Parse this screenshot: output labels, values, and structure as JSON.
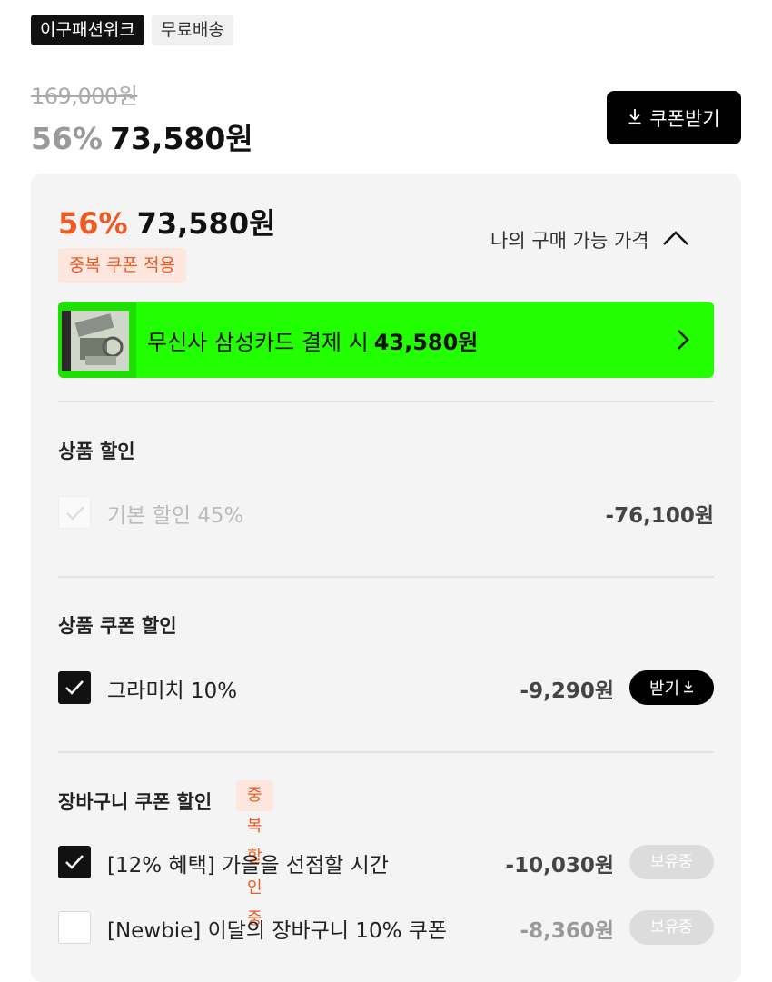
{
  "badges": {
    "store": "이구패션위크",
    "shipping": "무료배송"
  },
  "pricing": {
    "original": "169,000원",
    "discount_pct": "56%",
    "sale_price": "73,580원"
  },
  "coupon_button": {
    "label": "쿠폰받기",
    "icon": "download-icon"
  },
  "panel": {
    "discount_pct": "56%",
    "price": "73,580원",
    "dup_tag": "중복 쿠폰 적용",
    "mine_label": "나의 구매 가능 가격",
    "mine_icon": "chevron-up-icon",
    "card": {
      "text": "무신사 삼성카드 결제 시",
      "amount": "43,580원",
      "thumb_icon": "card-thumbnail-image",
      "chevron_icon": "chevron-right-icon"
    },
    "product_discount": {
      "title": "상품 할인",
      "items": [
        {
          "label": "기본 할인 45%",
          "amount": "-76,100원",
          "checked": true,
          "disabled": true
        }
      ]
    },
    "product_coupon": {
      "title": "상품 쿠폰 할인",
      "items": [
        {
          "label": "그라미치 10%",
          "amount": "-9,290원",
          "checked": true,
          "button": "받기"
        }
      ]
    },
    "cart_coupon": {
      "title": "장바구니 쿠폰 할인",
      "dup_tag": "중복 할인 중",
      "items": [
        {
          "label": "[12% 혜택] 가을을 선점할 시간",
          "amount": "-10,030원",
          "checked": true,
          "status": "보유중"
        },
        {
          "label": "[Newbie] 이달의 장바구니 10% 쿠폰",
          "amount": "-8,360원",
          "checked": false,
          "status": "보유중"
        }
      ]
    }
  },
  "colors": {
    "accent": "#f05a22",
    "card_green": "#22ff00",
    "dark": "#111111"
  }
}
